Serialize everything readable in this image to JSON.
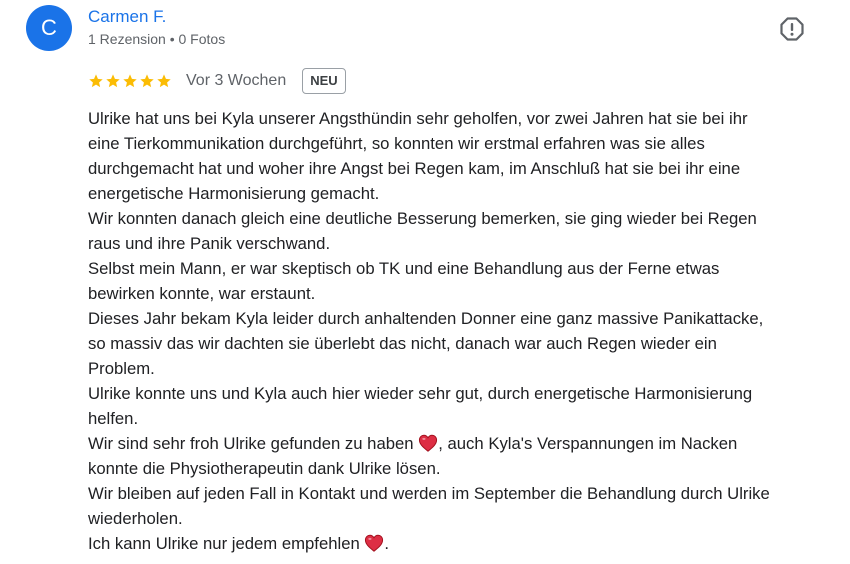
{
  "reviewer": {
    "initial": "C",
    "name": "Carmen F.",
    "meta": "1 Rezension • 0 Fotos",
    "avatar_color": "#1a73e8"
  },
  "rating": {
    "stars": 5,
    "max": 5,
    "star_color": "#fbbc04",
    "time": "Vor 3 Wochen",
    "badge": "NEU"
  },
  "icons": {
    "report": "report-flag-icon",
    "star": "star-icon",
    "heart": "red-heart-emoji"
  },
  "review_lines": [
    "Ulrike hat uns bei Kyla unserer Angsthündin sehr geholfen, vor zwei Jahren hat sie bei ihr",
    "eine Tierkommunikation durchgeführt, so konnten wir erstmal erfahren was sie alles",
    "durchgemacht hat und woher ihre Angst bei Regen kam, im Anschluß hat sie bei ihr eine",
    "energetische Harmonisierung gemacht.",
    "Wir konnten danach gleich eine deutliche Besserung bemerken, sie ging wieder bei Regen",
    "raus und ihre Panik verschwand.",
    "Selbst mein Mann, er war skeptisch ob TK und eine Behandlung aus der Ferne etwas",
    "bewirken konnte, war erstaunt.",
    "Dieses Jahr bekam Kyla leider durch anhaltenden Donner eine ganz massive Panikattacke,",
    "so massiv das wir dachten sie überlebt das nicht, danach war auch Regen wieder ein",
    "Problem.",
    "Ulrike konnte uns und Kyla auch hier wieder sehr gut, durch energetische Harmonisierung",
    "helfen."
  ],
  "line14_before": "Wir sind sehr froh Ulrike gefunden zu haben ",
  "line14_after": ", auch Kyla's Verspannungen im Nacken",
  "review_lines_2": [
    "konnte die Physiotherapeutin dank Ulrike lösen.",
    "Wir bleiben auf jeden Fall in Kontakt und werden im September die Behandlung durch Ulrike",
    "wiederholen."
  ],
  "last_before": "Ich kann Ulrike nur jedem empfehlen ",
  "last_after": "."
}
